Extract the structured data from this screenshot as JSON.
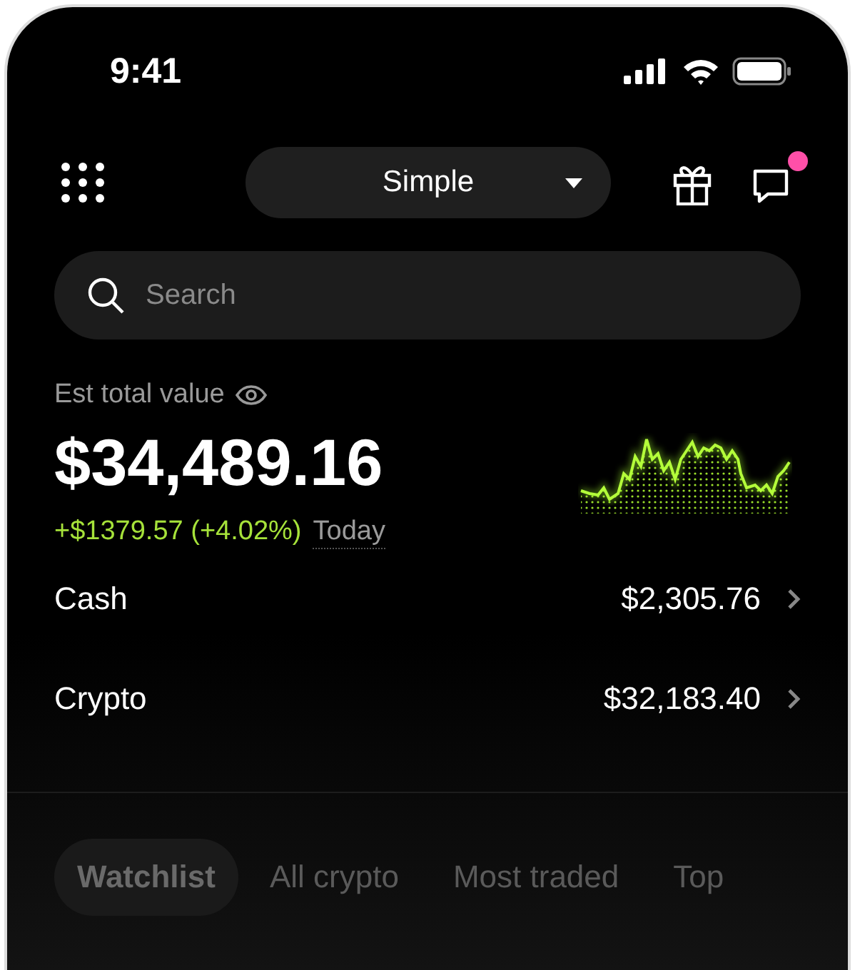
{
  "status_bar": {
    "time": "9:41"
  },
  "header": {
    "mode": "Simple",
    "notification": true
  },
  "search": {
    "placeholder": "Search"
  },
  "portfolio": {
    "label": "Est total value",
    "value": "$34,489.16",
    "change": "+$1379.57 (+4.02%)",
    "period": "Today"
  },
  "accounts": [
    {
      "name": "Cash",
      "amount": "$2,305.76"
    },
    {
      "name": "Crypto",
      "amount": "$32,183.40"
    }
  ],
  "tabs": [
    {
      "label": "Watchlist",
      "selected": true
    },
    {
      "label": "All crypto",
      "selected": false
    },
    {
      "label": "Most traded",
      "selected": false
    },
    {
      "label": "Top",
      "selected": false
    }
  ]
}
